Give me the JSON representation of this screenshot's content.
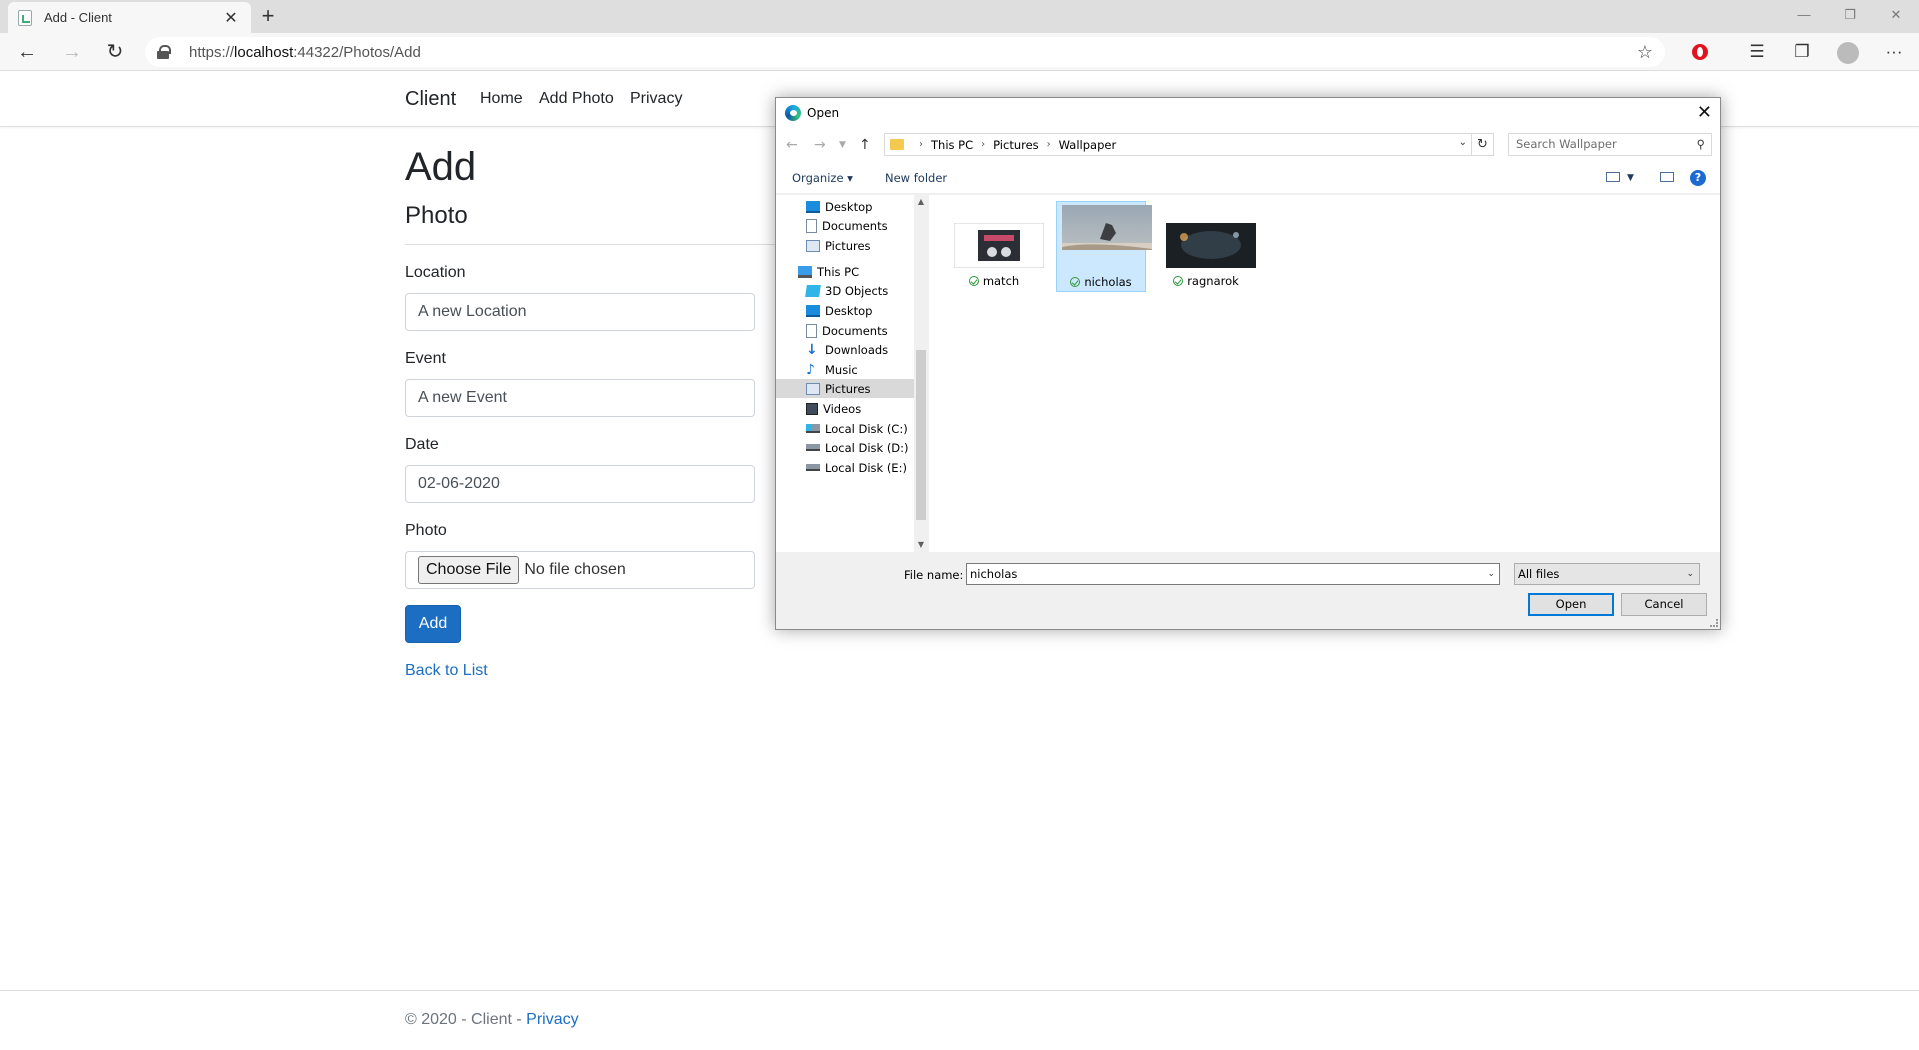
{
  "browser": {
    "tab_title": "Add - Client",
    "tab_close": "✕",
    "new_tab": "+",
    "url_proto": "https://",
    "url_host": "localhost",
    "url_path": ":44322/Photos/Add",
    "win_min": "—",
    "win_restore": "❐",
    "win_close": "✕",
    "star": "☆",
    "more": "···"
  },
  "site": {
    "brand": "Client",
    "nav": [
      "Home",
      "Add Photo",
      "Privacy"
    ],
    "heading": "Add",
    "subheading": "Photo",
    "form": {
      "location_label": "Location",
      "location_value": "A new Location",
      "event_label": "Event",
      "event_value": "A new Event",
      "date_label": "Date",
      "date_value": "02-06-2020",
      "photo_label": "Photo",
      "choose_file": "Choose File",
      "no_file": "No file chosen",
      "submit": "Add"
    },
    "back_link": "Back to List",
    "footer_text": "© 2020 - Client - ",
    "footer_link": "Privacy"
  },
  "dialog": {
    "title": "Open",
    "close": "✕",
    "breadcrumb": [
      "This PC",
      "Pictures",
      "Wallpaper"
    ],
    "search_placeholder": "Search Wallpaper",
    "toolbar": {
      "organize": "Organize ▾",
      "new_folder": "New folder",
      "help": "?"
    },
    "nav_quick": [
      "Desktop",
      "Documents",
      "Pictures"
    ],
    "nav_this_pc": "This PC",
    "nav_pc_items": [
      "3D Objects",
      "Desktop",
      "Documents",
      "Downloads",
      "Music",
      "Pictures",
      "Videos",
      "Local Disk (C:)",
      "Local Disk (D:)",
      "Local Disk (E:)"
    ],
    "selected_nav": "Pictures",
    "files": [
      {
        "name": "match",
        "selected": false
      },
      {
        "name": "nicholas",
        "selected": true
      },
      {
        "name": "ragnarok",
        "selected": false
      }
    ],
    "file_name_label": "File name:",
    "file_name_value": "nicholas",
    "filter": "All files",
    "open_button": "Open",
    "cancel_button": "Cancel"
  }
}
